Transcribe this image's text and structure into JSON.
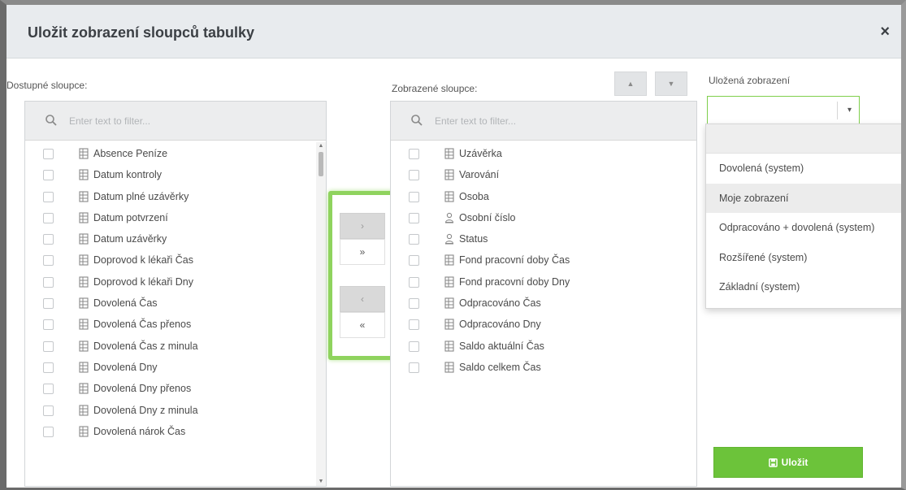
{
  "dialog": {
    "title": "Uložit zobrazení sloupců tabulky",
    "close_glyph": "×"
  },
  "available": {
    "label": "Dostupné sloupce:",
    "filter_placeholder": "Enter text to filter...",
    "items": [
      {
        "label": "Absence Peníze",
        "icon": "table-icon"
      },
      {
        "label": "Datum kontroly",
        "icon": "table-icon"
      },
      {
        "label": "Datum plné uzávěrky",
        "icon": "table-icon"
      },
      {
        "label": "Datum potvrzení",
        "icon": "table-icon"
      },
      {
        "label": "Datum uzávěrky",
        "icon": "table-icon"
      },
      {
        "label": "Doprovod k lékaři Čas",
        "icon": "table-icon"
      },
      {
        "label": "Doprovod k lékaři Dny",
        "icon": "table-icon"
      },
      {
        "label": "Dovolená Čas",
        "icon": "table-icon"
      },
      {
        "label": "Dovolená Čas přenos",
        "icon": "table-icon"
      },
      {
        "label": "Dovolená Čas z minula",
        "icon": "table-icon"
      },
      {
        "label": "Dovolená Dny",
        "icon": "table-icon"
      },
      {
        "label": "Dovolená Dny přenos",
        "icon": "table-icon"
      },
      {
        "label": "Dovolená Dny z minula",
        "icon": "table-icon"
      },
      {
        "label": "Dovolená nárok Čas",
        "icon": "table-icon"
      }
    ]
  },
  "transfer": {
    "move_right": "›",
    "move_all_right": "»",
    "move_left": "‹",
    "move_all_left": "«"
  },
  "displayed": {
    "label": "Zobrazené sloupce:",
    "filter_placeholder": "Enter text to filter...",
    "up_glyph": "▲",
    "down_glyph": "▼",
    "items": [
      {
        "label": "Uzávěrka",
        "icon": "table-icon"
      },
      {
        "label": "Varování",
        "icon": "table-icon"
      },
      {
        "label": "Osoba",
        "icon": "table-icon"
      },
      {
        "label": "Osobní číslo",
        "icon": "person-icon"
      },
      {
        "label": "Status",
        "icon": "person-icon"
      },
      {
        "label": "Fond pracovní doby Čas",
        "icon": "table-icon"
      },
      {
        "label": "Fond pracovní doby Dny",
        "icon": "table-icon"
      },
      {
        "label": "Odpracováno Čas",
        "icon": "table-icon"
      },
      {
        "label": "Odpracováno Dny",
        "icon": "table-icon"
      },
      {
        "label": "Saldo aktuální Čas",
        "icon": "table-icon"
      },
      {
        "label": "Saldo celkem Čas",
        "icon": "table-icon"
      }
    ]
  },
  "saved_views": {
    "label": "Uložená zobrazení",
    "selected": "",
    "caret_glyph": "▾",
    "options": [
      "Dovolená (system)",
      "Moje zobrazení",
      "Odpracováno + dovolená (system)",
      "Rozšířené (system)",
      "Základní (system)"
    ],
    "hovered_option_index": 1
  },
  "save_button": {
    "label": "Uložit",
    "icon": "floppy-disk-icon"
  },
  "colors": {
    "accent_green": "#6cc33a",
    "highlight_green": "#8fd35e",
    "header_bg": "#e8ebee"
  }
}
